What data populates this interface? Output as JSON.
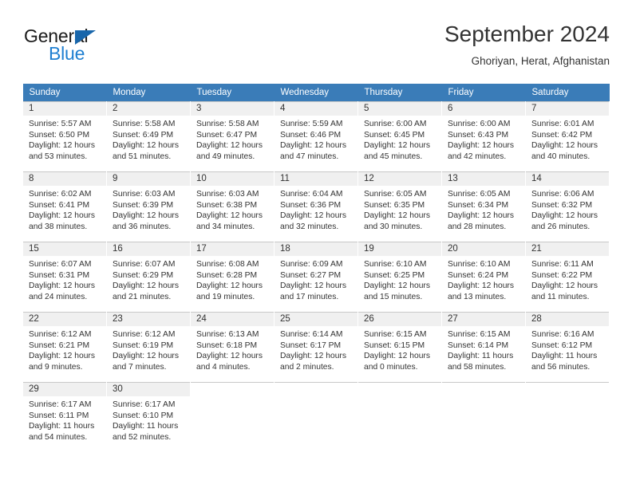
{
  "logo": {
    "word_one": "General",
    "word_two": "Blue",
    "sail_icon": "sail-triangle-icon",
    "accent_color": "#1f7fd1",
    "sail_color": "#1866ab"
  },
  "header": {
    "title": "September 2024",
    "subtitle": "Ghoriyan, Herat, Afghanistan"
  },
  "calendar": {
    "header_bg": "#3a7cb8",
    "daynum_bg": "#f0f0f0",
    "weekday_headers": [
      "Sunday",
      "Monday",
      "Tuesday",
      "Wednesday",
      "Thursday",
      "Friday",
      "Saturday"
    ],
    "labels": {
      "sunrise": "Sunrise:",
      "sunset": "Sunset:",
      "daylight": "Daylight:"
    },
    "weeks": [
      [
        {
          "day": "1",
          "sunrise": "Sunrise: 5:57 AM",
          "sunset": "Sunset: 6:50 PM",
          "daylight_line1": "Daylight: 12 hours",
          "daylight_line2": "and 53 minutes."
        },
        {
          "day": "2",
          "sunrise": "Sunrise: 5:58 AM",
          "sunset": "Sunset: 6:49 PM",
          "daylight_line1": "Daylight: 12 hours",
          "daylight_line2": "and 51 minutes."
        },
        {
          "day": "3",
          "sunrise": "Sunrise: 5:58 AM",
          "sunset": "Sunset: 6:47 PM",
          "daylight_line1": "Daylight: 12 hours",
          "daylight_line2": "and 49 minutes."
        },
        {
          "day": "4",
          "sunrise": "Sunrise: 5:59 AM",
          "sunset": "Sunset: 6:46 PM",
          "daylight_line1": "Daylight: 12 hours",
          "daylight_line2": "and 47 minutes."
        },
        {
          "day": "5",
          "sunrise": "Sunrise: 6:00 AM",
          "sunset": "Sunset: 6:45 PM",
          "daylight_line1": "Daylight: 12 hours",
          "daylight_line2": "and 45 minutes."
        },
        {
          "day": "6",
          "sunrise": "Sunrise: 6:00 AM",
          "sunset": "Sunset: 6:43 PM",
          "daylight_line1": "Daylight: 12 hours",
          "daylight_line2": "and 42 minutes."
        },
        {
          "day": "7",
          "sunrise": "Sunrise: 6:01 AM",
          "sunset": "Sunset: 6:42 PM",
          "daylight_line1": "Daylight: 12 hours",
          "daylight_line2": "and 40 minutes."
        }
      ],
      [
        {
          "day": "8",
          "sunrise": "Sunrise: 6:02 AM",
          "sunset": "Sunset: 6:41 PM",
          "daylight_line1": "Daylight: 12 hours",
          "daylight_line2": "and 38 minutes."
        },
        {
          "day": "9",
          "sunrise": "Sunrise: 6:03 AM",
          "sunset": "Sunset: 6:39 PM",
          "daylight_line1": "Daylight: 12 hours",
          "daylight_line2": "and 36 minutes."
        },
        {
          "day": "10",
          "sunrise": "Sunrise: 6:03 AM",
          "sunset": "Sunset: 6:38 PM",
          "daylight_line1": "Daylight: 12 hours",
          "daylight_line2": "and 34 minutes."
        },
        {
          "day": "11",
          "sunrise": "Sunrise: 6:04 AM",
          "sunset": "Sunset: 6:36 PM",
          "daylight_line1": "Daylight: 12 hours",
          "daylight_line2": "and 32 minutes."
        },
        {
          "day": "12",
          "sunrise": "Sunrise: 6:05 AM",
          "sunset": "Sunset: 6:35 PM",
          "daylight_line1": "Daylight: 12 hours",
          "daylight_line2": "and 30 minutes."
        },
        {
          "day": "13",
          "sunrise": "Sunrise: 6:05 AM",
          "sunset": "Sunset: 6:34 PM",
          "daylight_line1": "Daylight: 12 hours",
          "daylight_line2": "and 28 minutes."
        },
        {
          "day": "14",
          "sunrise": "Sunrise: 6:06 AM",
          "sunset": "Sunset: 6:32 PM",
          "daylight_line1": "Daylight: 12 hours",
          "daylight_line2": "and 26 minutes."
        }
      ],
      [
        {
          "day": "15",
          "sunrise": "Sunrise: 6:07 AM",
          "sunset": "Sunset: 6:31 PM",
          "daylight_line1": "Daylight: 12 hours",
          "daylight_line2": "and 24 minutes."
        },
        {
          "day": "16",
          "sunrise": "Sunrise: 6:07 AM",
          "sunset": "Sunset: 6:29 PM",
          "daylight_line1": "Daylight: 12 hours",
          "daylight_line2": "and 21 minutes."
        },
        {
          "day": "17",
          "sunrise": "Sunrise: 6:08 AM",
          "sunset": "Sunset: 6:28 PM",
          "daylight_line1": "Daylight: 12 hours",
          "daylight_line2": "and 19 minutes."
        },
        {
          "day": "18",
          "sunrise": "Sunrise: 6:09 AM",
          "sunset": "Sunset: 6:27 PM",
          "daylight_line1": "Daylight: 12 hours",
          "daylight_line2": "and 17 minutes."
        },
        {
          "day": "19",
          "sunrise": "Sunrise: 6:10 AM",
          "sunset": "Sunset: 6:25 PM",
          "daylight_line1": "Daylight: 12 hours",
          "daylight_line2": "and 15 minutes."
        },
        {
          "day": "20",
          "sunrise": "Sunrise: 6:10 AM",
          "sunset": "Sunset: 6:24 PM",
          "daylight_line1": "Daylight: 12 hours",
          "daylight_line2": "and 13 minutes."
        },
        {
          "day": "21",
          "sunrise": "Sunrise: 6:11 AM",
          "sunset": "Sunset: 6:22 PM",
          "daylight_line1": "Daylight: 12 hours",
          "daylight_line2": "and 11 minutes."
        }
      ],
      [
        {
          "day": "22",
          "sunrise": "Sunrise: 6:12 AM",
          "sunset": "Sunset: 6:21 PM",
          "daylight_line1": "Daylight: 12 hours",
          "daylight_line2": "and 9 minutes."
        },
        {
          "day": "23",
          "sunrise": "Sunrise: 6:12 AM",
          "sunset": "Sunset: 6:19 PM",
          "daylight_line1": "Daylight: 12 hours",
          "daylight_line2": "and 7 minutes."
        },
        {
          "day": "24",
          "sunrise": "Sunrise: 6:13 AM",
          "sunset": "Sunset: 6:18 PM",
          "daylight_line1": "Daylight: 12 hours",
          "daylight_line2": "and 4 minutes."
        },
        {
          "day": "25",
          "sunrise": "Sunrise: 6:14 AM",
          "sunset": "Sunset: 6:17 PM",
          "daylight_line1": "Daylight: 12 hours",
          "daylight_line2": "and 2 minutes."
        },
        {
          "day": "26",
          "sunrise": "Sunrise: 6:15 AM",
          "sunset": "Sunset: 6:15 PM",
          "daylight_line1": "Daylight: 12 hours",
          "daylight_line2": "and 0 minutes."
        },
        {
          "day": "27",
          "sunrise": "Sunrise: 6:15 AM",
          "sunset": "Sunset: 6:14 PM",
          "daylight_line1": "Daylight: 11 hours",
          "daylight_line2": "and 58 minutes."
        },
        {
          "day": "28",
          "sunrise": "Sunrise: 6:16 AM",
          "sunset": "Sunset: 6:12 PM",
          "daylight_line1": "Daylight: 11 hours",
          "daylight_line2": "and 56 minutes."
        }
      ],
      [
        {
          "day": "29",
          "sunrise": "Sunrise: 6:17 AM",
          "sunset": "Sunset: 6:11 PM",
          "daylight_line1": "Daylight: 11 hours",
          "daylight_line2": "and 54 minutes."
        },
        {
          "day": "30",
          "sunrise": "Sunrise: 6:17 AM",
          "sunset": "Sunset: 6:10 PM",
          "daylight_line1": "Daylight: 11 hours",
          "daylight_line2": "and 52 minutes."
        },
        {
          "day": "",
          "sunrise": "",
          "sunset": "",
          "daylight_line1": "",
          "daylight_line2": ""
        },
        {
          "day": "",
          "sunrise": "",
          "sunset": "",
          "daylight_line1": "",
          "daylight_line2": ""
        },
        {
          "day": "",
          "sunrise": "",
          "sunset": "",
          "daylight_line1": "",
          "daylight_line2": ""
        },
        {
          "day": "",
          "sunrise": "",
          "sunset": "",
          "daylight_line1": "",
          "daylight_line2": ""
        },
        {
          "day": "",
          "sunrise": "",
          "sunset": "",
          "daylight_line1": "",
          "daylight_line2": ""
        }
      ]
    ]
  }
}
